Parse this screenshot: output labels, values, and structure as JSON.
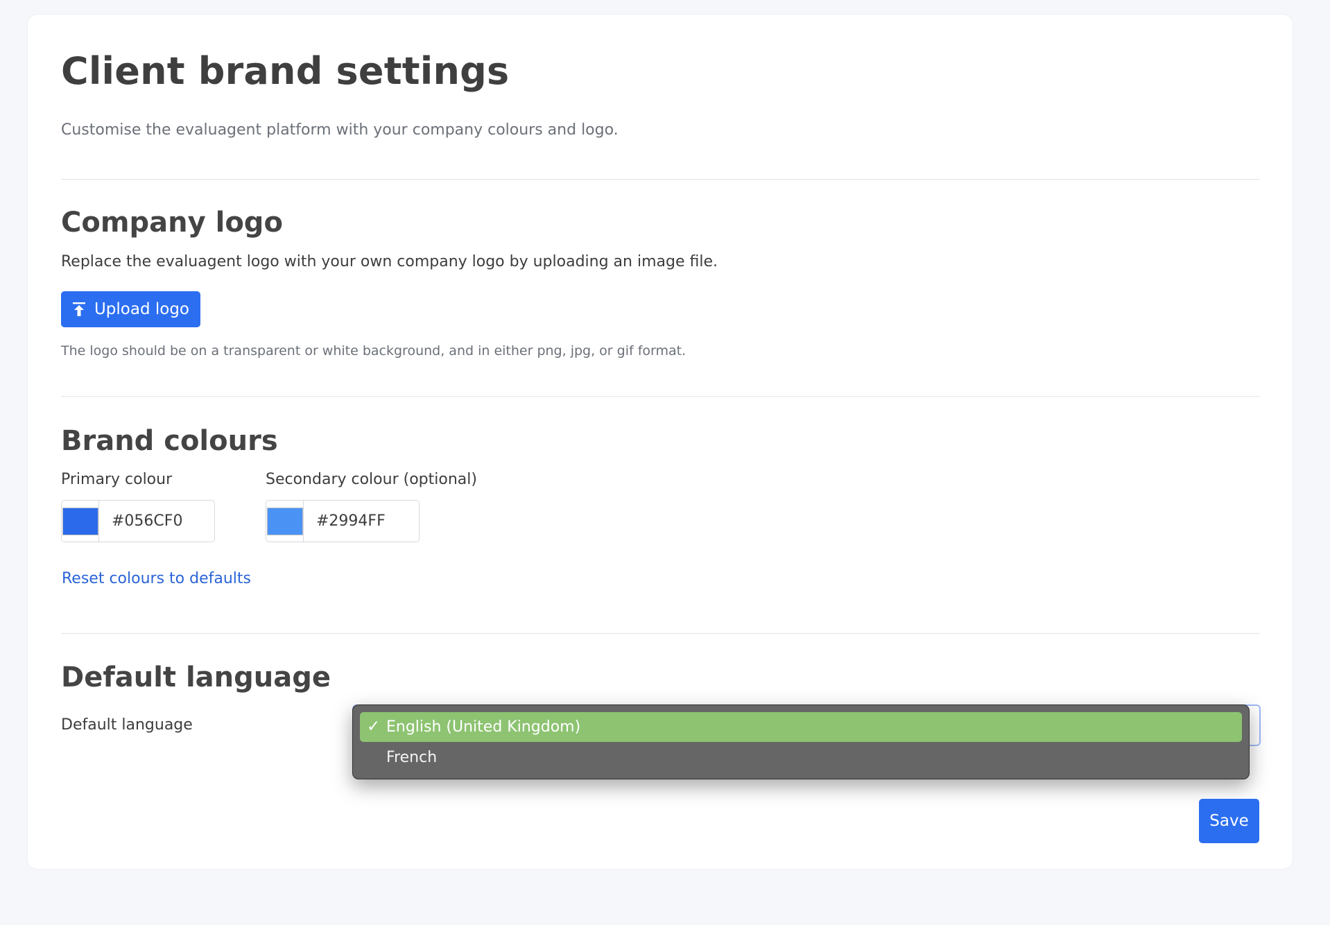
{
  "page": {
    "title": "Client brand settings",
    "subtitle": "Customise the evaluagent platform with your company colours and logo."
  },
  "logo_section": {
    "heading": "Company logo",
    "description": "Replace the evaluagent logo with your own company logo by uploading an image file.",
    "upload_label": "Upload logo",
    "upload_icon": "upload-icon",
    "help": "The logo should be on a transparent or white background, and in either png, jpg, or gif format."
  },
  "colours_section": {
    "heading": "Brand colours",
    "primary": {
      "label": "Primary colour",
      "value": "#056CF0",
      "swatch": "#2b6aea"
    },
    "secondary": {
      "label": "Secondary colour (optional)",
      "value": "#2994FF",
      "swatch": "#4a93f4"
    },
    "reset_label": "Reset colours to defaults"
  },
  "language_section": {
    "heading": "Default language",
    "field_label": "Default language",
    "options": [
      {
        "label": "English (United Kingdom)",
        "selected": true
      },
      {
        "label": "French",
        "selected": false
      }
    ],
    "check_glyph": "✓"
  },
  "actions": {
    "save_label": "Save"
  },
  "colors": {
    "accent": "#2b6ef0",
    "link": "#2a64d6",
    "selected_option": "#8dc371",
    "dropdown_bg": "#666666"
  }
}
